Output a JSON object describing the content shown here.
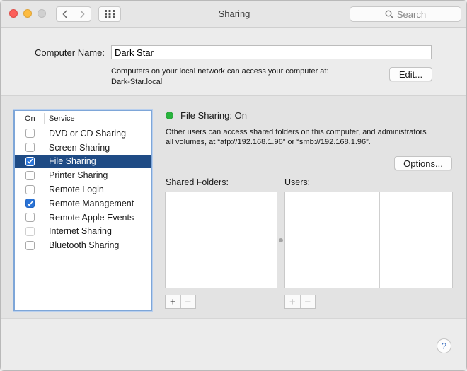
{
  "window": {
    "title": "Sharing",
    "nav_back": "‹",
    "nav_forward": "›",
    "search_placeholder": "Search"
  },
  "computer_name": {
    "label": "Computer Name:",
    "value": "Dark Star",
    "info_line1": "Computers on your local network can access your computer at:",
    "info_line2": "Dark-Star.local",
    "edit_label": "Edit..."
  },
  "services": {
    "header_on": "On",
    "header_service": "Service",
    "items": [
      {
        "label": "DVD or CD Sharing",
        "checked": false
      },
      {
        "label": "Screen Sharing",
        "checked": false
      },
      {
        "label": "File Sharing",
        "checked": true,
        "selected": true
      },
      {
        "label": "Printer Sharing",
        "checked": false
      },
      {
        "label": "Remote Login",
        "checked": false
      },
      {
        "label": "Remote Management",
        "checked": true
      },
      {
        "label": "Remote Apple Events",
        "checked": false
      },
      {
        "label": "Internet Sharing",
        "checked": false
      },
      {
        "label": "Bluetooth Sharing",
        "checked": false
      }
    ]
  },
  "detail": {
    "status": "File Sharing: On",
    "status_color": "#2ab43e",
    "description_line1": "Other users can access shared folders on this computer, and administrators",
    "description_line2": "all volumes, at “afp://192.168.1.96” or “smb://192.168.1.96”.",
    "options_label": "Options...",
    "shared_folders_label": "Shared Folders:",
    "users_label": "Users:",
    "add_label": "+",
    "remove_label": "−"
  },
  "help_label": "?",
  "colors": {
    "selection": "#1f4b85",
    "checkbox_checked": "#2a73d6",
    "list_focus_ring": "#7ea6d8"
  }
}
